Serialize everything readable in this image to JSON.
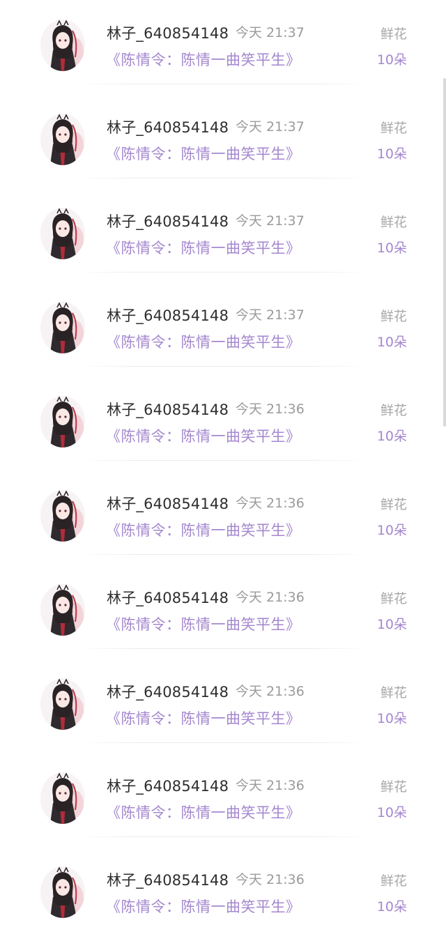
{
  "gift_list": {
    "rows": [
      {
        "username": "林子_640854148",
        "time": "今天 21:37",
        "book": "《陈情令：陈情一曲笑平生》",
        "gift_type": "鲜花",
        "gift_count": "10朵"
      },
      {
        "username": "林子_640854148",
        "time": "今天 21:37",
        "book": "《陈情令：陈情一曲笑平生》",
        "gift_type": "鲜花",
        "gift_count": "10朵"
      },
      {
        "username": "林子_640854148",
        "time": "今天 21:37",
        "book": "《陈情令：陈情一曲笑平生》",
        "gift_type": "鲜花",
        "gift_count": "10朵"
      },
      {
        "username": "林子_640854148",
        "time": "今天 21:37",
        "book": "《陈情令：陈情一曲笑平生》",
        "gift_type": "鲜花",
        "gift_count": "10朵"
      },
      {
        "username": "林子_640854148",
        "time": "今天 21:36",
        "book": "《陈情令：陈情一曲笑平生》",
        "gift_type": "鲜花",
        "gift_count": "10朵"
      },
      {
        "username": "林子_640854148",
        "time": "今天 21:36",
        "book": "《陈情令：陈情一曲笑平生》",
        "gift_type": "鲜花",
        "gift_count": "10朵"
      },
      {
        "username": "林子_640854148",
        "time": "今天 21:36",
        "book": "《陈情令：陈情一曲笑平生》",
        "gift_type": "鲜花",
        "gift_count": "10朵"
      },
      {
        "username": "林子_640854148",
        "time": "今天 21:36",
        "book": "《陈情令：陈情一曲笑平生》",
        "gift_type": "鲜花",
        "gift_count": "10朵"
      },
      {
        "username": "林子_640854148",
        "time": "今天 21:36",
        "book": "《陈情令：陈情一曲笑平生》",
        "gift_type": "鲜花",
        "gift_count": "10朵"
      },
      {
        "username": "林子_640854148",
        "time": "今天 21:36",
        "book": "《陈情令：陈情一曲笑平生》",
        "gift_type": "鲜花",
        "gift_count": "10朵"
      }
    ]
  },
  "colors": {
    "accent_purple": "#a487cf",
    "username_text": "#2e2e2e",
    "muted_text": "#9a9a9a"
  },
  "icons": {
    "avatar": "anime-character-avatar"
  }
}
